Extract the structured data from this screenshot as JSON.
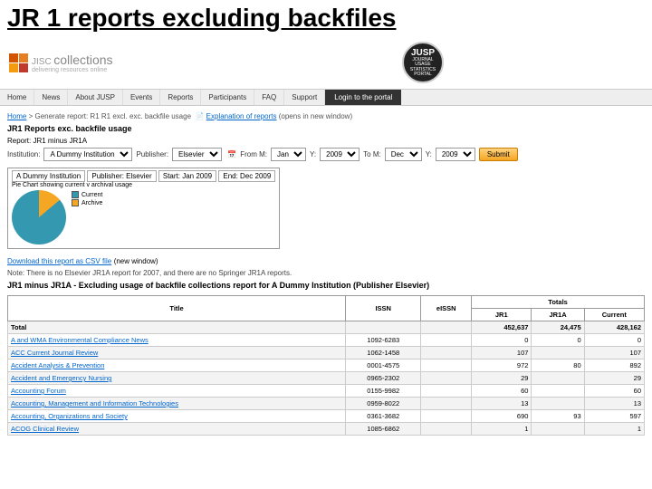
{
  "slide_title": "JR 1 reports excluding backfiles",
  "brand": {
    "name": "collections",
    "prefix": "JISC",
    "tagline": "delivering resources online"
  },
  "jusp": {
    "line1": "JOURNAL",
    "line2": "USAGE",
    "line3": "STATISTICS",
    "line4": "PORTAL",
    "short": "JUSP"
  },
  "nav": {
    "items": [
      "Home",
      "News",
      "About JUSP",
      "Events",
      "Reports",
      "Participants",
      "FAQ",
      "Support"
    ],
    "login": "Login to the portal"
  },
  "breadcrumb": {
    "home": "Home",
    "sep": ">",
    "text": "Generate report:",
    "report": "R1 R1 excl. exc. backfile usage",
    "explain": "Explanation of reports",
    "explain_note": "(opens in new window)"
  },
  "heading1": "JR1 Reports exc. backfile usage",
  "heading2": "Report: JR1 minus JR1A",
  "form": {
    "institution_label": "Institution:",
    "institution": "A Dummy Institution",
    "publisher_label": "Publisher:",
    "publisher": "Elsevier",
    "from_label": "From M:",
    "from_m": "Jan",
    "from_y_label": "Y:",
    "from_y": "2009",
    "to_label": "To M:",
    "to_m": "Dec",
    "to_y_label": "Y:",
    "to_y": "2009",
    "submit": "Submit"
  },
  "chart_box": {
    "title": "A Dummy Institution",
    "pub": "Publisher: Elsevier",
    "start": "Start: Jan 2009",
    "end": "End: Dec 2009",
    "subtitle": "Pie Chart showing current v archival usage"
  },
  "chart_data": {
    "type": "pie",
    "title": "Current vs Archive usage",
    "series": [
      {
        "name": "Current",
        "value": 86
      },
      {
        "name": "Archive",
        "value": 14
      }
    ],
    "colors": {
      "Current": "#3498b0",
      "Archive": "#f5a623"
    }
  },
  "legend": {
    "current": "Current",
    "archive": "Archive"
  },
  "download": {
    "text": "Download this report as CSV file",
    "note": "(new window)"
  },
  "note": "Note: There is no Elsevier JR1A report for 2007, and there are no Springer JR1A reports.",
  "table_title": "JR1 minus JR1A - Excluding usage of backfile collections report for A Dummy Institution (Publisher Elsevier)",
  "columns": {
    "title": "Title",
    "issn": "ISSN",
    "eissn": "eISSN",
    "totals": "Totals",
    "jr1": "JR1",
    "jr1a": "JR1A",
    "current": "Current"
  },
  "total_row": {
    "label": "Total",
    "jr1": "452,637",
    "jr1a": "24,475",
    "current": "428,162"
  },
  "rows": [
    {
      "title": "A and WMA Environmental Compliance News",
      "issn": "1092-6283",
      "eissn": "",
      "jr1": "0",
      "jr1a": "0",
      "current": "0"
    },
    {
      "title": "ACC Current Journal Review",
      "issn": "1062-1458",
      "eissn": "",
      "jr1": "107",
      "jr1a": "",
      "current": "107"
    },
    {
      "title": "Accident Analysis & Prevention",
      "issn": "0001-4575",
      "eissn": "",
      "jr1": "972",
      "jr1a": "80",
      "current": "892"
    },
    {
      "title": "Accident and Emergency Nursing",
      "issn": "0965-2302",
      "eissn": "",
      "jr1": "29",
      "jr1a": "",
      "current": "29"
    },
    {
      "title": "Accounting Forum",
      "issn": "0155-9982",
      "eissn": "",
      "jr1": "60",
      "jr1a": "",
      "current": "60"
    },
    {
      "title": "Accounting, Management and Information Technologies",
      "issn": "0959-8022",
      "eissn": "",
      "jr1": "13",
      "jr1a": "",
      "current": "13"
    },
    {
      "title": "Accounting, Organizations and Society",
      "issn": "0361-3682",
      "eissn": "",
      "jr1": "690",
      "jr1a": "93",
      "current": "597"
    },
    {
      "title": "ACOG Clinical Review",
      "issn": "1085-6862",
      "eissn": "",
      "jr1": "1",
      "jr1a": "",
      "current": "1"
    }
  ]
}
